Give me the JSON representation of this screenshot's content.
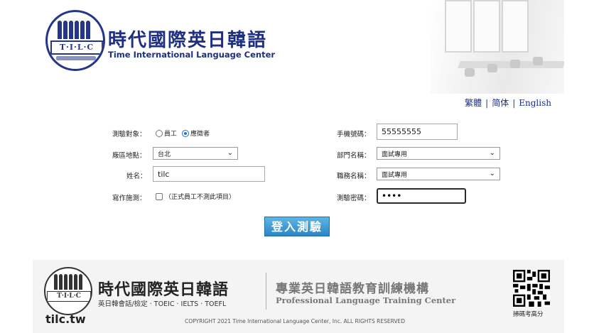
{
  "header": {
    "logo_text": "T·I·L·C",
    "brand_cn": "時代國際英日韓語",
    "brand_en": "Time International Language Center"
  },
  "languages": [
    {
      "label": "繁體"
    },
    {
      "label": "简体"
    },
    {
      "label": "English"
    }
  ],
  "form": {
    "test_target_label": "測驗對象：",
    "radio_employee": "員工",
    "radio_applicant": "應徵者",
    "radio_selected": "應徵者",
    "region_label": "廠區地點：",
    "region_value": "台北",
    "name_label": "姓名：",
    "name_value": "tilc",
    "writing_label": "寫作施測：",
    "writing_note": "（正式員工不測此項目）",
    "phone_label": "手機號碼：",
    "phone_value": "55555555",
    "dept_label": "部門名稱：",
    "dept_value": "面試專用",
    "position_label": "職務名稱：",
    "position_value": "面試專用",
    "password_label": "測驗密碼：",
    "password_value": "••••",
    "login_button": "登入測驗"
  },
  "footer": {
    "logo_text": "T·I·L·C",
    "brand_cn": "時代國際英日韓語",
    "subtitle": "英日韓會話/檢定 · TOEIC · IELTS · TOEFL",
    "url": "tilc.tw",
    "tagline_cn": "專業英日韓語教育訓練機構",
    "tagline_en": "Professional Language Training Center",
    "copyright": "COPYRIGHT    2021    Time International Language Center, Inc.    ALL RIGHTS RESERVED",
    "qr_label": "掃碼考高分"
  },
  "colors": {
    "brand_navy": "#1d2f83",
    "button_blue": "#2b86c6",
    "footer_bg": "#f4f4f4"
  }
}
